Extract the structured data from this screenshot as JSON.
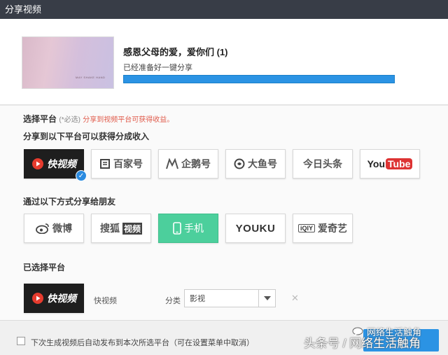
{
  "window": {
    "title": "分享视频"
  },
  "video": {
    "title": "感恩父母的爱，爱你们 (1)",
    "status": "已经准备好一键分享",
    "progress_pct": 100,
    "thumbnail_caption": "MAY SHAKE HAND"
  },
  "platform_section": {
    "label": "选择平台",
    "required": "(*必选)",
    "hint": "分享到视频平台可获得收益。"
  },
  "revenue_section": {
    "label": "分享到以下平台可以获得分成收入",
    "platforms": [
      {
        "label": "快视频",
        "icon": "kuaishipin-play-icon",
        "selected": true
      },
      {
        "label": "百家号",
        "icon": "baijiahao-logo-icon",
        "selected": false
      },
      {
        "label": "企鹅号",
        "icon": "penguin-logo-icon",
        "selected": false
      },
      {
        "label": "大鱼号",
        "icon": "fish-logo-icon",
        "selected": false
      },
      {
        "label": "今日头条",
        "icon": "",
        "selected": false
      },
      {
        "label_a": "You",
        "label_b": "Tube",
        "selected": false
      }
    ]
  },
  "friends_section": {
    "label": "通过以下方式分享给朋友",
    "platforms": [
      {
        "label": "微博",
        "icon": "weibo-icon"
      },
      {
        "label_a": "搜狐",
        "label_b": "视频",
        "icon": ""
      },
      {
        "label": "手机",
        "icon": "phone-icon",
        "active": true
      },
      {
        "label": "YOUKU",
        "icon": ""
      },
      {
        "label_a": "iQIY",
        "label_b": "爱奇艺",
        "icon": "iqiyi-logo-icon"
      }
    ]
  },
  "selected_section": {
    "label": "已选择平台",
    "platform_tile": "快视频",
    "platform_name": "快视频",
    "category_label": "分类",
    "category_value": "影视"
  },
  "footer": {
    "checkbox_label": "下次生成视频后自动发布到本次所选平台（可在设置菜单中取消）",
    "checkbox_checked": false,
    "watermark": "头条号 / 网络生活触角",
    "watermark_top": "网络生活触角"
  },
  "colors": {
    "titlebar": "#383d47",
    "accent": "#2b93e4",
    "selected_tile": "#1e1e1e",
    "active_tile": "#4ccf9c",
    "hint": "#e05a4a"
  }
}
